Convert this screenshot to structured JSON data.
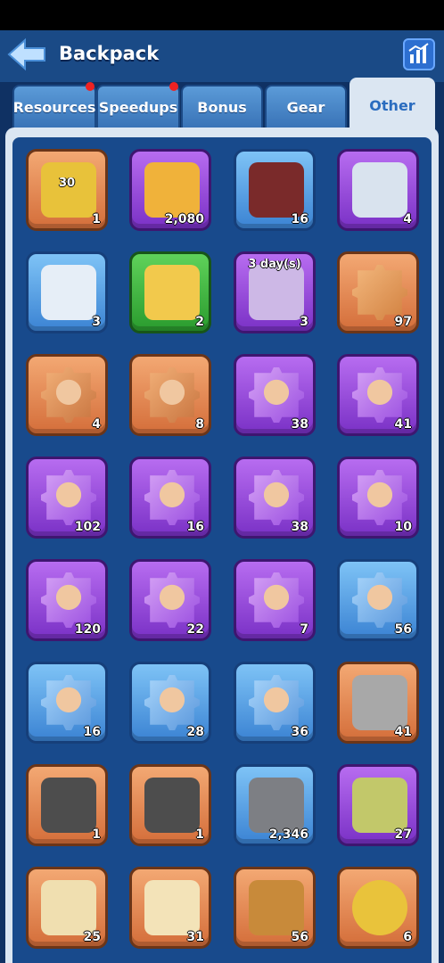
{
  "header": {
    "title": "Backpack"
  },
  "tabs": [
    {
      "label": "Resources",
      "dot": true
    },
    {
      "label": "Speedups",
      "dot": true
    },
    {
      "label": "Bonus",
      "dot": false
    },
    {
      "label": "Gear",
      "dot": false
    },
    {
      "label": "Other",
      "dot": false,
      "active": true
    }
  ],
  "items": [
    {
      "name": "ticket-30-icon",
      "rarity": "orange",
      "count": "1",
      "label": "30"
    },
    {
      "name": "mystery-chest-icon",
      "rarity": "purple",
      "count": "2,080"
    },
    {
      "name": "horn-icon",
      "rarity": "blue",
      "count": "16"
    },
    {
      "name": "hero-pedestal-icon",
      "rarity": "purple",
      "count": "4"
    },
    {
      "name": "banner-pedestal-icon",
      "rarity": "blue",
      "count": "3"
    },
    {
      "name": "mystery-pedestal-icon",
      "rarity": "green",
      "count": "2"
    },
    {
      "name": "frame-3day-icon",
      "rarity": "purple",
      "count": "3",
      "label": "3 day(s)"
    },
    {
      "name": "puzzle-piece-icon",
      "rarity": "orange",
      "count": "97"
    },
    {
      "name": "hero-shard-icon",
      "rarity": "orange",
      "count": "4"
    },
    {
      "name": "hero-shard-icon",
      "rarity": "orange",
      "count": "8"
    },
    {
      "name": "hero-shard-icon",
      "rarity": "purple",
      "count": "38"
    },
    {
      "name": "hero-shard-icon",
      "rarity": "purple",
      "count": "41"
    },
    {
      "name": "hero-shard-icon",
      "rarity": "purple",
      "count": "102"
    },
    {
      "name": "hero-shard-icon",
      "rarity": "purple",
      "count": "16"
    },
    {
      "name": "hero-shard-icon",
      "rarity": "purple",
      "count": "38"
    },
    {
      "name": "hero-shard-icon",
      "rarity": "purple",
      "count": "10"
    },
    {
      "name": "hero-shard-icon",
      "rarity": "purple",
      "count": "120"
    },
    {
      "name": "hero-shard-icon",
      "rarity": "purple",
      "count": "22"
    },
    {
      "name": "hero-shard-icon",
      "rarity": "purple",
      "count": "7"
    },
    {
      "name": "hero-shard-icon",
      "rarity": "blue",
      "count": "56"
    },
    {
      "name": "hero-shard-icon",
      "rarity": "blue",
      "count": "16"
    },
    {
      "name": "hero-shard-icon",
      "rarity": "blue",
      "count": "28"
    },
    {
      "name": "hero-shard-icon",
      "rarity": "blue",
      "count": "36"
    },
    {
      "name": "whetstone-icon",
      "rarity": "orange",
      "count": "41"
    },
    {
      "name": "gear-part-icon",
      "rarity": "orange",
      "count": "1"
    },
    {
      "name": "gear-part-icon",
      "rarity": "orange",
      "count": "1"
    },
    {
      "name": "iron-ingot-icon",
      "rarity": "blue",
      "count": "2,346"
    },
    {
      "name": "potion-bottle-icon",
      "rarity": "purple",
      "count": "27"
    },
    {
      "name": "scroll-icon",
      "rarity": "orange",
      "count": "25"
    },
    {
      "name": "blueprint-icon",
      "rarity": "orange",
      "count": "31"
    },
    {
      "name": "book-icon",
      "rarity": "orange",
      "count": "56"
    },
    {
      "name": "gold-coin-icon",
      "rarity": "orange",
      "count": "6"
    }
  ]
}
